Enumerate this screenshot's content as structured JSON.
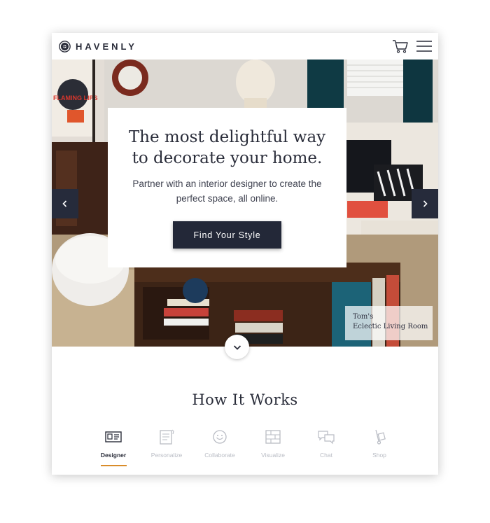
{
  "header": {
    "brand": "HAVENLY",
    "cart_icon": "shopping-cart-icon",
    "menu_icon": "hamburger-menu-icon"
  },
  "hero": {
    "title": "The most delightful way to decorate your home.",
    "subtitle": "Partner with an interior designer to create the perfect space, all online.",
    "cta_label": "Find Your Style",
    "prev_icon": "chevron-left-icon",
    "next_icon": "chevron-right-icon",
    "caption_line1": "Tom's",
    "caption_line2": "Eclectic Living Room",
    "scroll_icon": "chevron-down-icon",
    "poster_text": "FLAMING LIPS"
  },
  "how_it_works": {
    "title": "How It Works",
    "steps": [
      {
        "label": "Designer",
        "icon": "designer-card-icon",
        "active": true
      },
      {
        "label": "Personalize",
        "icon": "notepad-pencil-icon",
        "active": false
      },
      {
        "label": "Collaborate",
        "icon": "smiley-face-icon",
        "active": false
      },
      {
        "label": "Visualize",
        "icon": "brick-wall-icon",
        "active": false
      },
      {
        "label": "Chat",
        "icon": "chat-bubbles-icon",
        "active": false
      },
      {
        "label": "Shop",
        "icon": "hand-truck-icon",
        "active": false
      }
    ],
    "accent_color": "#d98c2a"
  },
  "colors": {
    "navy": "#232838",
    "text": "#2a2d3a",
    "muted": "#b9bcc4"
  }
}
